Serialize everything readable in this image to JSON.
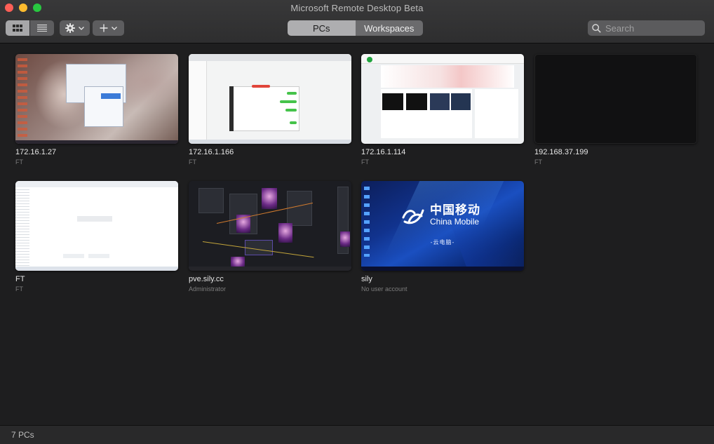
{
  "window": {
    "title": "Microsoft Remote Desktop Beta"
  },
  "toolbar": {
    "view_modes": [
      {
        "name": "grid",
        "icon": "grid-icon",
        "active": true
      },
      {
        "name": "list",
        "icon": "list-icon",
        "active": false
      }
    ],
    "settings_icon": "gear-icon",
    "add_icon": "plus-icon",
    "tabs": [
      {
        "label": "PCs",
        "active": true
      },
      {
        "label": "Workspaces",
        "active": false
      }
    ],
    "search": {
      "placeholder": "Search",
      "value": ""
    }
  },
  "pcs": [
    {
      "name": "172.16.1.27",
      "user": "FT"
    },
    {
      "name": "172.16.1.166",
      "user": "FT"
    },
    {
      "name": "172.16.1.114",
      "user": "FT"
    },
    {
      "name": "192.168.37.199",
      "user": "FT"
    },
    {
      "name": "FT",
      "user": "FT"
    },
    {
      "name": "pve.sily.cc",
      "user": "Administrator"
    },
    {
      "name": "sily",
      "user": "No user account"
    }
  ],
  "wallpaper_branding": {
    "cn": "中国移动",
    "en": "China Mobile",
    "sub": "-云电脑-"
  },
  "status": {
    "count_label": "7 PCs"
  },
  "colors": {
    "close": "#fe5f57",
    "minimize": "#febc2e",
    "maximize": "#28c840",
    "accent_segment": "#aeaeb0"
  }
}
